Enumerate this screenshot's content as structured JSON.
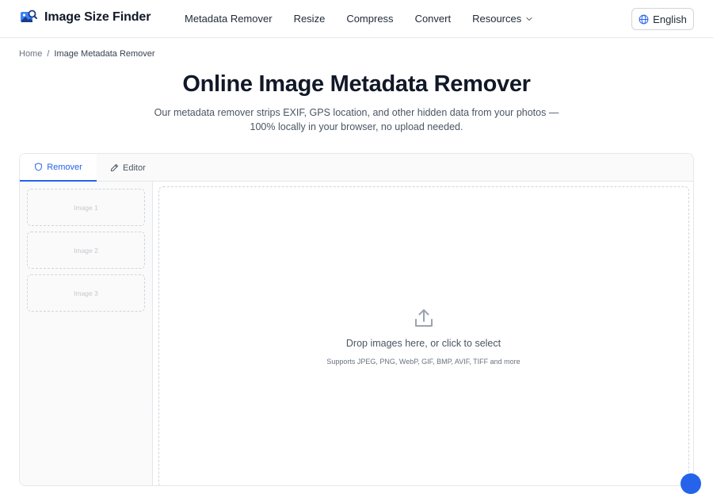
{
  "brand": {
    "name": "Image Size Finder",
    "logo_icon": "image-search-logo-icon"
  },
  "nav": {
    "items": [
      {
        "label": "Metadata Remover"
      },
      {
        "label": "Resize"
      },
      {
        "label": "Compress"
      },
      {
        "label": "Convert"
      },
      {
        "label": "Resources",
        "has_dropdown": true
      }
    ]
  },
  "language": {
    "label": "English",
    "icon": "globe-icon"
  },
  "breadcrumb": {
    "home": "Home",
    "separator": "/",
    "current": "Image Metadata Remover"
  },
  "main": {
    "title": "Online Image Metadata Remover",
    "subtitle": "Our metadata remover strips EXIF, GPS location, and other hidden data from your photos — 100% locally in your browser, no upload needed."
  },
  "tabs": [
    {
      "label": "Remover",
      "icon": "shield-icon",
      "active": true
    },
    {
      "label": "Editor",
      "icon": "pencil-icon",
      "active": false
    }
  ],
  "sidebar": {
    "slots": [
      "Image 1",
      "Image 2",
      "Image 3"
    ]
  },
  "dropzone": {
    "icon": "upload-icon",
    "title": "Drop images here, or click to select",
    "hint": "Supports JPEG, PNG, WebP, GIF, BMP, AVIF, TIFF and more"
  },
  "colors": {
    "accent": "#2563eb",
    "border": "#e5e7eb",
    "text": "#1f2937"
  }
}
